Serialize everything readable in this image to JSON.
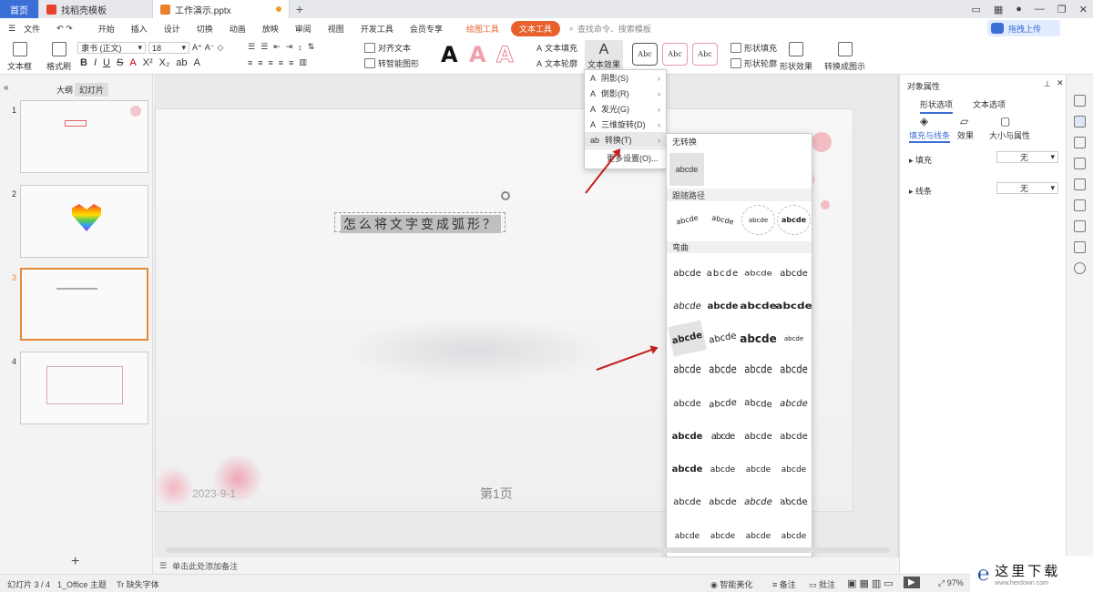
{
  "tabs": {
    "home": "首页",
    "template": "找稻壳模板",
    "doc": "工作演示.pptx"
  },
  "menu": {
    "file": "文件",
    "items": [
      "开始",
      "插入",
      "设计",
      "切换",
      "动画",
      "放映",
      "审阅",
      "视图",
      "开发工具",
      "会员专享"
    ],
    "draw_tools": "绘图工具",
    "text_tools": "文本工具",
    "search": "查找命令、搜索模板",
    "cloud": "拖拽上传"
  },
  "ribbon": {
    "textbox": "文本框",
    "format_painter": "格式刷",
    "font": "隶书 (正文)",
    "size": "18",
    "align_text": "对齐文本",
    "smart_shape": "转智能图形",
    "text_fill": "文本填充",
    "text_outline": "文本轮廓",
    "text_effect": "文本效果",
    "shape_fill": "形状填充",
    "shape_outline": "形状轮廓",
    "shape_effect": "形状效果",
    "convert_show": "转换成图示",
    "styles": [
      "Abc",
      "Abc",
      "Abc"
    ]
  },
  "left": {
    "outline": "大纲",
    "slides": "幻灯片",
    "nums": [
      "1",
      "2",
      "3",
      "4"
    ]
  },
  "slide": {
    "title": "怎么将文字变成弧形？",
    "page": "第1页",
    "date": "2023-9-1"
  },
  "fxmenu": [
    {
      "label": "阴影(S)"
    },
    {
      "label": "倒影(R)"
    },
    {
      "label": "发光(G)"
    },
    {
      "label": "三维旋转(D)"
    },
    {
      "label": "转换(T)"
    },
    {
      "label": "更多设置(O)..."
    }
  ],
  "submenu": {
    "none": "无转换",
    "none_sample": "abcde",
    "path": "跟随路径",
    "warp": "弯曲",
    "sample": "abcde"
  },
  "rightpanel": {
    "title": "对象属性",
    "tab_shape": "形状选项",
    "tab_text": "文本选项",
    "sub": [
      "填充与线条",
      "效果",
      "大小与属性"
    ],
    "fill": "填充",
    "line": "线条",
    "none": "无"
  },
  "notes": "单击此处添加备注",
  "status": {
    "slide": "幻灯片 3 / 4",
    "theme": "1_Office 主题",
    "font_missing": "缺失字体",
    "smart": "智能美化",
    "notes": "备注",
    "comment": "批注",
    "zoom": "97%"
  },
  "watermark": {
    "text": "这里下载",
    "url": "www.herdown.com"
  }
}
